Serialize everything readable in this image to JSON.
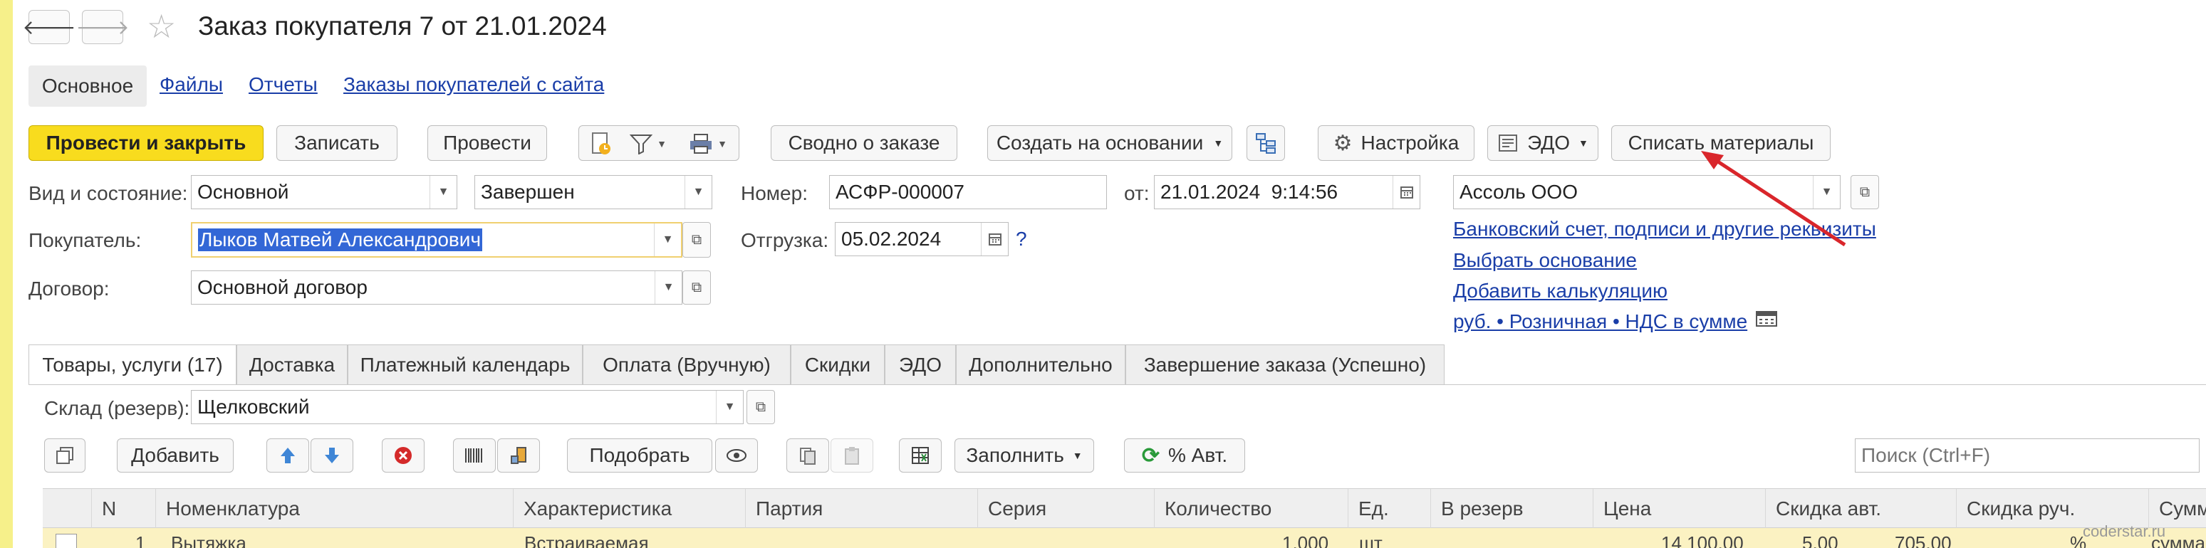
{
  "window": {
    "title": "Заказ покупателя 7 от 21.01.2024"
  },
  "nav": {
    "back": "🡐",
    "forward": "🡒",
    "star": "☆"
  },
  "top_tabs": [
    "Основное",
    "Файлы",
    "Отчеты",
    "Заказы покупателей с сайта"
  ],
  "toolbar": {
    "post_close": "Провести и закрыть",
    "save": "Записать",
    "post": "Провести",
    "summary": "Сводно о заказе",
    "create_based": "Создать на основании",
    "settings": "Настройка",
    "edo": "ЭДО",
    "write_off": "Списать материалы"
  },
  "form": {
    "kind_label": "Вид и состояние:",
    "kind_value": "Основной",
    "state_value": "Завершен",
    "number_label": "Номер:",
    "number_value": "АСФР-000007",
    "from_label": "от:",
    "date_value": "21.01.2024  9:14:56",
    "org_value": "Ассоль ООО",
    "buyer_label": "Покупатель:",
    "buyer_value": "Лыков Матвей Александрович",
    "shipment_label": "Отгрузка:",
    "shipment_value": "05.02.2024",
    "help": "?",
    "contract_label": "Договор:",
    "contract_value": "Основной договор"
  },
  "links": {
    "bank": "Банковский счет, подписи и другие реквизиты",
    "basis": "Выбрать основание",
    "calc": "Добавить калькуляцию",
    "price": "руб. • Розничная • НДС в сумме"
  },
  "doc_tabs": [
    "Товары, услуги (17)",
    "Доставка",
    "Платежный календарь",
    "Оплата (Вручную)",
    "Скидки",
    "ЭДО",
    "Дополнительно",
    "Завершение заказа (Успешно)"
  ],
  "warehouse": {
    "label": "Склад (резерв):",
    "value": "Щелковский"
  },
  "table_toolbar": {
    "add": "Добавить",
    "pick": "Подобрать",
    "fill": "Заполнить",
    "auto_pct": "% Авт.",
    "search_placeholder": "Поиск (Ctrl+F)"
  },
  "table": {
    "columns": [
      "N",
      "Номенклатура",
      "Характеристика",
      "Партия",
      "Серия",
      "Количество",
      "Ед.",
      "В резерв",
      "Цена",
      "Скидка авт.",
      "Скидка руч.",
      "Сумма"
    ],
    "row1": [
      "1",
      "Вытяжка",
      "Встраиваемая",
      "",
      "",
      "1,000",
      "шт",
      "",
      "14 100,00",
      "5,00",
      "705,00",
      "%",
      "сумма"
    ]
  },
  "watermark": "coderstar.ru",
  "colors": {
    "accent": "#f8dc1e",
    "link": "#1a3ea8",
    "selection": "#3367d6",
    "arrow": "#d9262b"
  }
}
